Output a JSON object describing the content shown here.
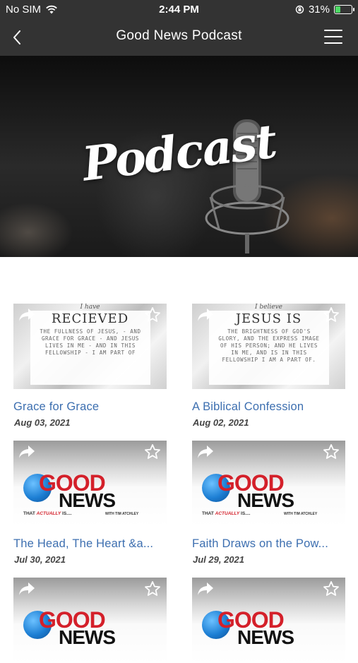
{
  "status_bar": {
    "carrier": "No SIM",
    "time": "2:44 PM",
    "battery_percent": "31%",
    "battery_level": 0.31,
    "battery_color": "#4cd964"
  },
  "nav": {
    "title": "Good News Podcast",
    "back_icon": "chevron-left-icon",
    "menu_icon": "hamburger-menu-icon"
  },
  "hero": {
    "heading": "Podcast"
  },
  "episodes": [
    {
      "title": "Grace for Grace",
      "date": "Aug 03, 2021",
      "thumb": "marble",
      "thumb_tag": "I have",
      "thumb_title": "RECIEVED",
      "thumb_text": "THE FULLNESS OF JESUS, - AND GRACE FOR GRACE - AND JESUS LIVES IN ME - AND IN THIS FELLOWSHIP - I AM PART OF"
    },
    {
      "title": "A Biblical Confession",
      "date": "Aug 02, 2021",
      "thumb": "marble",
      "thumb_tag": "I believe",
      "thumb_title": "JESUS IS",
      "thumb_text": "THE BRIGHTNESS OF GOD'S GLORY, AND THE EXPRESS IMAGE OF HIS PERSON; AND HE LIVES IN ME, AND IS IN THIS FELLOWSHIP I AM A PART OF."
    },
    {
      "title": "The Head, The Heart &a...",
      "date": "Jul 30, 2021",
      "thumb": "good-news",
      "logo_word1": "GOOD",
      "logo_word2": "NEWS",
      "logo_sub_a": "THAT ",
      "logo_sub_em": "ACTUALLY",
      "logo_sub_b": " IS....",
      "logo_sub2": "WITH TIM ATCHLEY"
    },
    {
      "title": "Faith Draws on the Pow...",
      "date": "Jul 29, 2021",
      "thumb": "good-news",
      "logo_word1": "GOOD",
      "logo_word2": "NEWS",
      "logo_sub_a": "THAT ",
      "logo_sub_em": "ACTUALLY",
      "logo_sub_b": " IS....",
      "logo_sub2": "WITH TIM ATCHLEY"
    },
    {
      "title": "",
      "date": "",
      "thumb": "good-news",
      "logo_word1": "GOOD",
      "logo_word2": "NEWS",
      "logo_sub_a": "",
      "logo_sub_em": "",
      "logo_sub_b": "",
      "logo_sub2": ""
    },
    {
      "title": "",
      "date": "",
      "thumb": "good-news",
      "logo_word1": "GOOD",
      "logo_word2": "NEWS",
      "logo_sub_a": "",
      "logo_sub_em": "",
      "logo_sub_b": "",
      "logo_sub2": ""
    }
  ],
  "card_icons": {
    "share": "share-arrow-icon",
    "favorite": "star-outline-icon"
  },
  "colors": {
    "bar_bg": "#333333",
    "link": "#3d6fb0",
    "logo_red": "#d4202a",
    "logo_blue": "#1d7fd4"
  }
}
